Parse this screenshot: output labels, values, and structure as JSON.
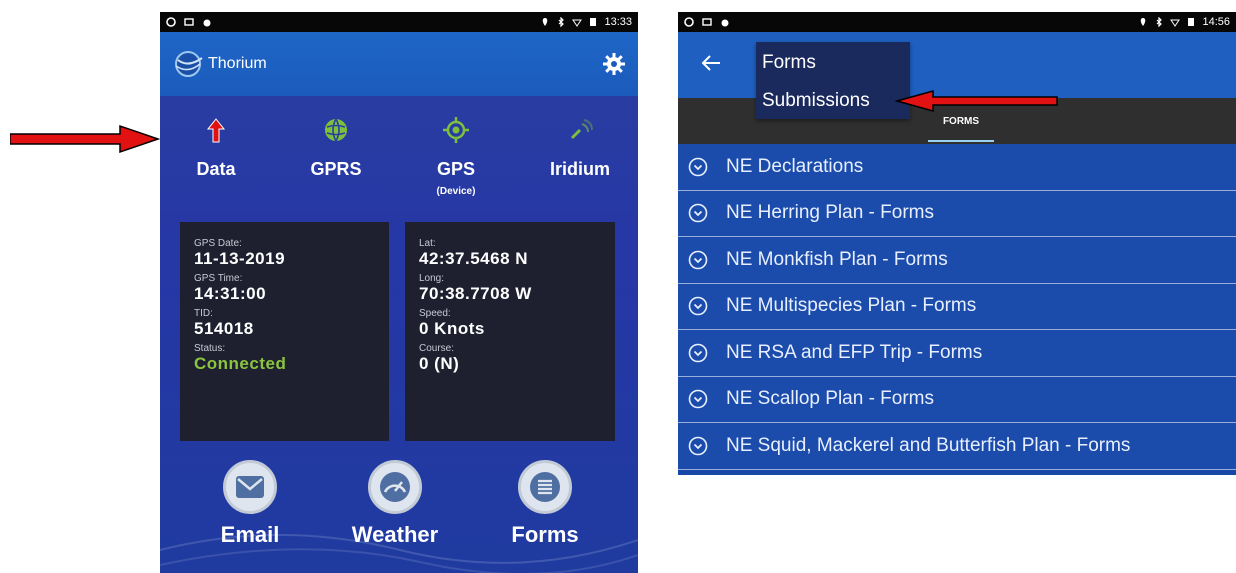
{
  "left": {
    "status": {
      "time": "13:33"
    },
    "app_title": "Thorium",
    "stats": [
      {
        "label": "Data",
        "sub": "",
        "icon": "arrow-up-icon"
      },
      {
        "label": "GPRS",
        "sub": "",
        "icon": "globe-icon"
      },
      {
        "label": "GPS",
        "sub": "(Device)",
        "icon": "target-icon"
      },
      {
        "label": "Iridium",
        "sub": "",
        "icon": "satellite-icon"
      }
    ],
    "card_left": {
      "gps_date_key": "GPS Date:",
      "gps_date_val": "11-13-2019",
      "gps_time_key": "GPS Time:",
      "gps_time_val": "14:31:00",
      "tid_key": "TID:",
      "tid_val": "514018",
      "status_key": "Status:",
      "status_val": "Connected"
    },
    "card_right": {
      "lat_key": "Lat:",
      "lat_val": "42:37.5468 N",
      "long_key": "Long:",
      "long_val": "70:38.7708 W",
      "speed_key": "Speed:",
      "speed_val": "0 Knots",
      "course_key": "Course:",
      "course_val": "0 (N)"
    },
    "nav": {
      "email_label": "Email",
      "weather_label": "Weather",
      "forms_label": "Forms"
    }
  },
  "right": {
    "status": {
      "time": "14:56"
    },
    "menu": {
      "item1": "Forms",
      "item2": "Submissions"
    },
    "tab_forms": "FORMS",
    "forms": [
      "NE Declarations",
      "NE Herring Plan - Forms",
      "NE Monkfish Plan - Forms",
      "NE Multispecies Plan - Forms",
      "NE RSA and EFP Trip - Forms",
      "NE Scallop Plan - Forms",
      "NE Squid, Mackerel and Butterfish Plan - Forms"
    ]
  },
  "colors": {
    "accent": "#1e5fc0",
    "connected": "#8bc43f",
    "arrow": "#e21212"
  }
}
